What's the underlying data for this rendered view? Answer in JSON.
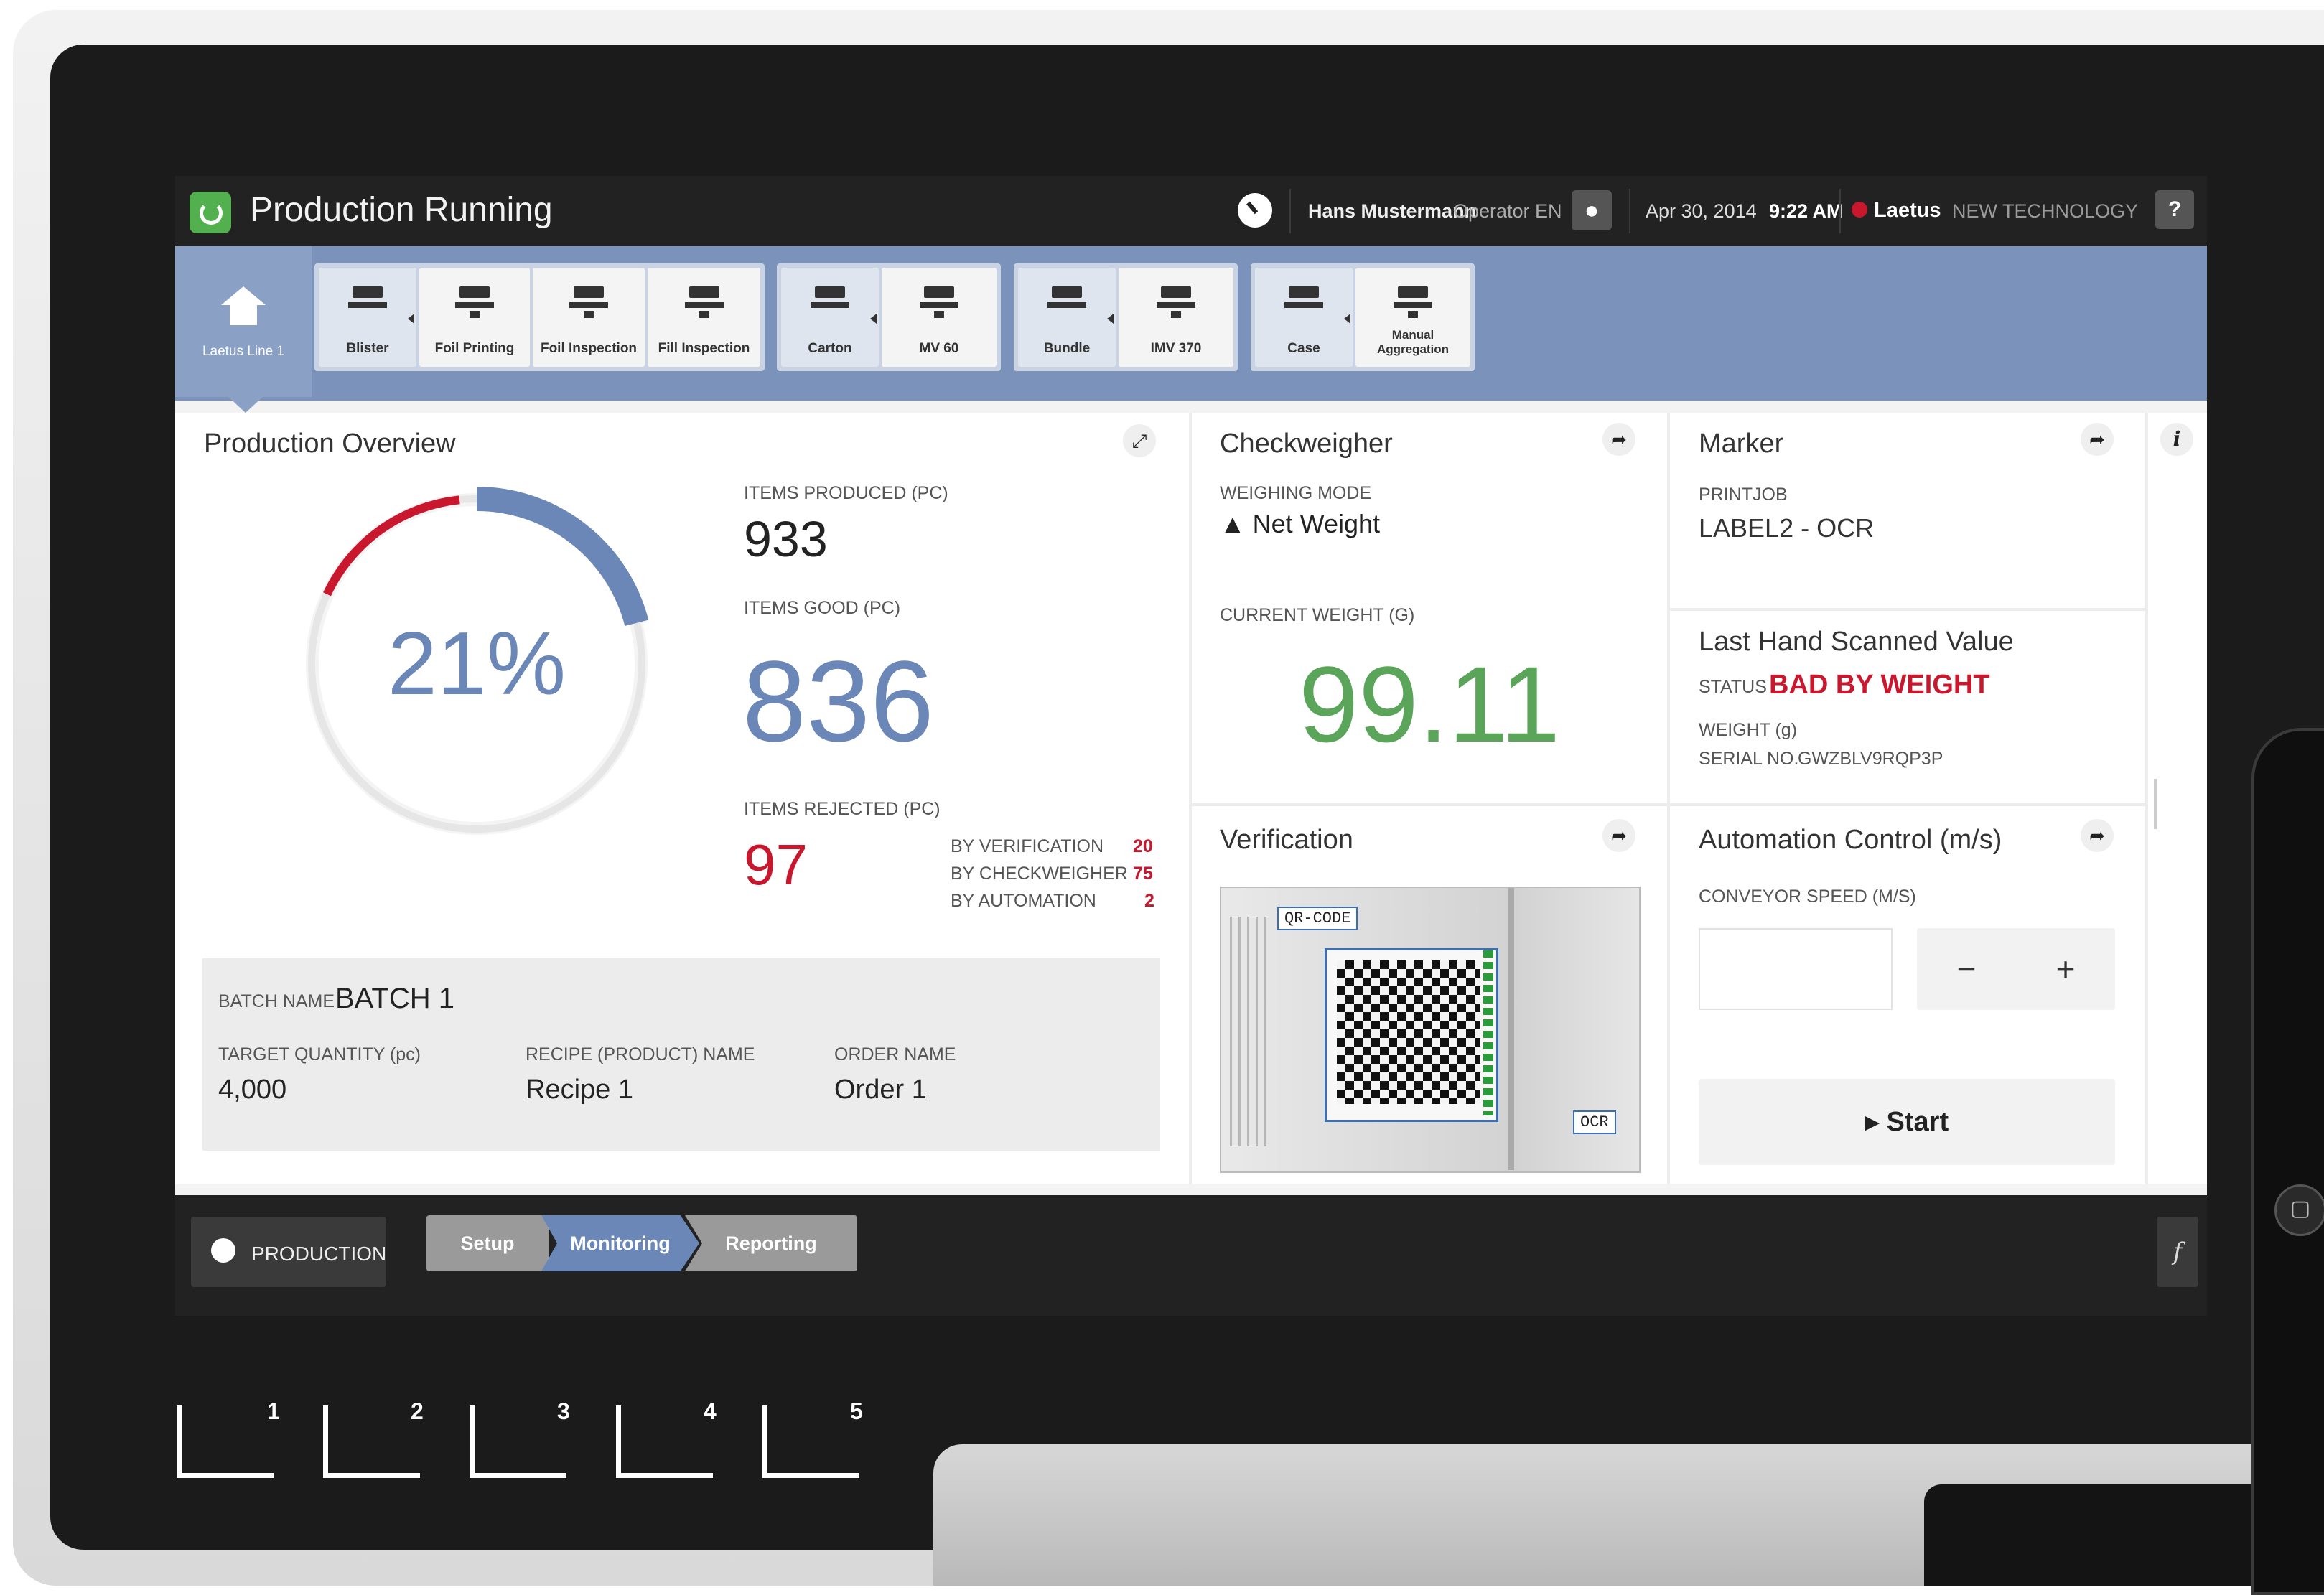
{
  "device": {
    "slots": [
      "1",
      "2",
      "3",
      "4",
      "5"
    ],
    "side_button_icon": "square-icon"
  },
  "topbar": {
    "status": "Production Running",
    "user_name": "Hans Mustermann",
    "user_role": "Operator EN",
    "date": "Apr 30, 2014",
    "time": "9:22 AM",
    "brand": "Laetus",
    "brand_suffix": "NEW TECHNOLOGY",
    "help": "?",
    "status_color": "#52b04e"
  },
  "stations": {
    "home": "Laetus Line 1",
    "groups": [
      [
        "Blister",
        "Foil Printing",
        "Foil Inspection",
        "Fill Inspection"
      ],
      [
        "Carton",
        "MV 60"
      ],
      [
        "Bundle",
        "IMV 370"
      ],
      [
        "Case",
        "Manual Aggregation"
      ]
    ]
  },
  "overview": {
    "title": "Production Overview",
    "percent": "21%",
    "progress": 0.21,
    "items_produced_label": "ITEMS PRODUCED (pc)",
    "items_produced": "933",
    "items_good_label": "ITEMS GOOD (pc)",
    "items_good": "836",
    "items_rejected_label": "ITEMS REJECTED (pc)",
    "items_rejected": "97",
    "rejections": [
      {
        "label": "BY VERIFICATION",
        "value": "20"
      },
      {
        "label": "BY CHECKWEIGHER",
        "value": "75"
      },
      {
        "label": "BY AUTOMATION",
        "value": "2"
      }
    ],
    "accent": "#6a87b8",
    "reject_color": "#c9172d"
  },
  "batch": {
    "batch_label": "BATCH NAME",
    "batch_value": "BATCH 1",
    "target_label": "TARGET QUANTITY (pc)",
    "target_value": "4,000",
    "recipe_label": "RECIPE (PRODUCT) NAME",
    "recipe_value": "Recipe 1",
    "order_label": "ORDER NAME",
    "order_value": "Order 1"
  },
  "checkweigher": {
    "title": "Checkweigher",
    "mode_label": "WEIGHING MODE",
    "mode_value": "Net Weight",
    "weight_label": "CURRENT WEIGHT (G)",
    "weight_value": "99.11",
    "weight_color": "#5aa55a"
  },
  "marker": {
    "title": "Marker",
    "printjob_label": "PRINTJOB",
    "printjob_value": "LABEL2 - OCR"
  },
  "scan": {
    "title": "Last Hand Scanned Value",
    "status_label": "STATUS",
    "status_value": "BAD BY WEIGHT",
    "weight_label": "WEIGHT (g)",
    "serial_label": "SERIAL NO.",
    "serial_value": "GWZBLV9RQP3P"
  },
  "verification": {
    "title": "Verification",
    "qr_label": "QR-CODE",
    "ocr_label": "OCR"
  },
  "automation": {
    "title": "Automation Control (m/s)",
    "speed_label": "CONVEYOR SPEED (m/s)",
    "speed_value": "",
    "minus": "−",
    "plus": "+",
    "start": "Start"
  },
  "bottombar": {
    "mode": "PRODUCTION",
    "steps": [
      "Setup",
      "Monitoring",
      "Reporting"
    ],
    "active_step": "Monitoring",
    "right_icon": "f"
  }
}
